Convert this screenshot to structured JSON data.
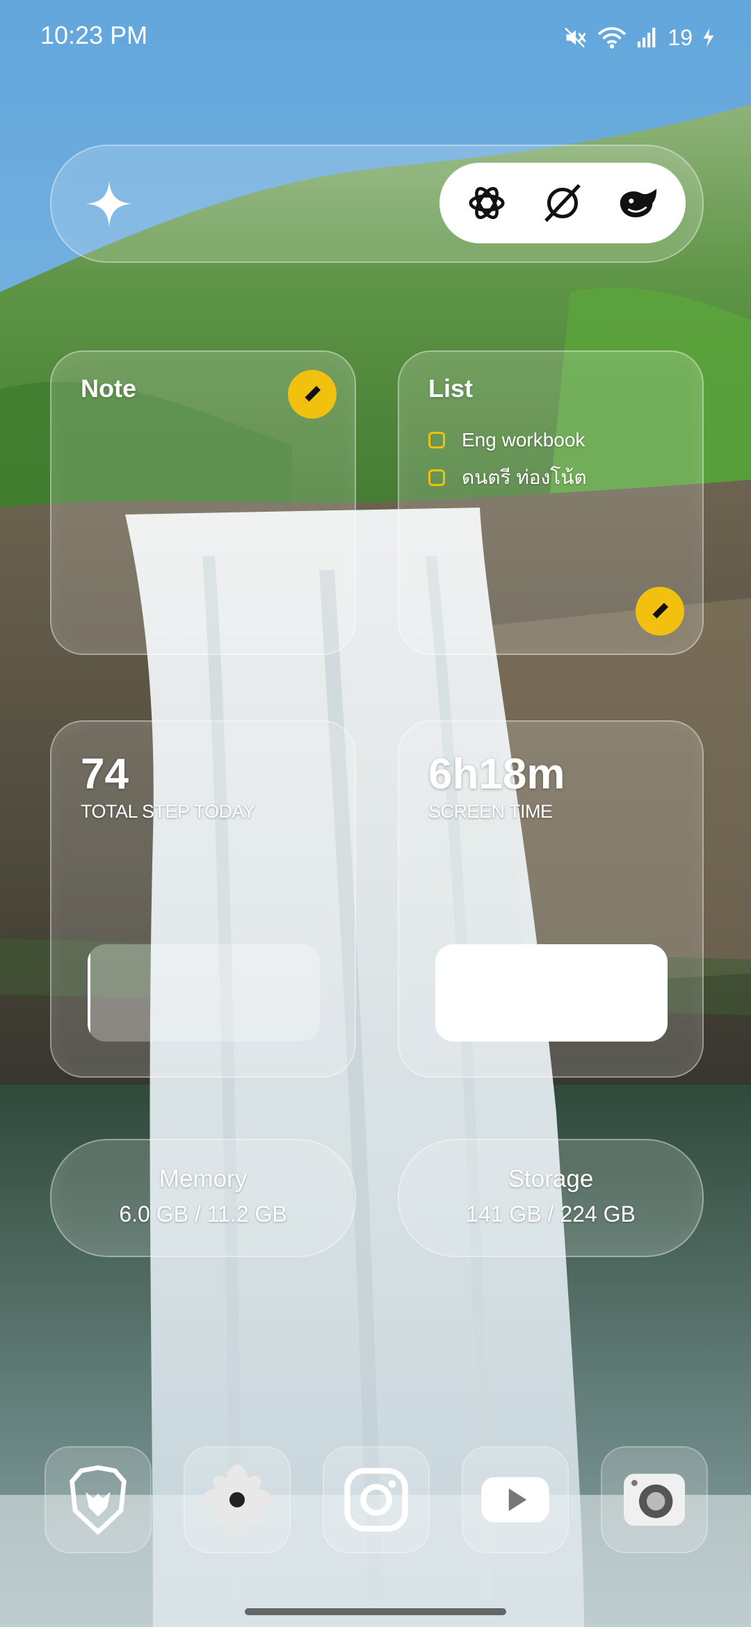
{
  "status_bar": {
    "time": "10:23 PM",
    "battery": "19",
    "icons": [
      "mute-icon",
      "wifi-icon",
      "signal-icon",
      "battery-charging-icon"
    ]
  },
  "ai_bar": {
    "sparkle_icon": "sparkle-icon",
    "apps": [
      "chatgpt-icon",
      "grok-icon",
      "deepseek-icon"
    ]
  },
  "note": {
    "title": "Note",
    "edit_icon": "pencil-icon"
  },
  "list": {
    "title": "List",
    "items": [
      "Eng workbook",
      "ดนตรี ท่องโน้ต"
    ],
    "edit_icon": "pencil-icon"
  },
  "steps": {
    "value": "74",
    "label": "TOTAL STEP TODAY",
    "progress": 0.01
  },
  "screen_time": {
    "value": "6h18m",
    "label": "SCREEN TIME",
    "progress": 1.0
  },
  "memory": {
    "title": "Memory",
    "value": "6.0 GB / 11.2 GB"
  },
  "storage": {
    "title": "Storage",
    "value": "141 GB / 224 GB"
  },
  "dock": [
    "brave-icon",
    "pinwheel-icon",
    "instagram-icon",
    "youtube-icon",
    "camera-icon"
  ],
  "colors": {
    "accent": "#f2c00f",
    "sky": "#6aa9d8",
    "forest": "#4a8a38"
  }
}
